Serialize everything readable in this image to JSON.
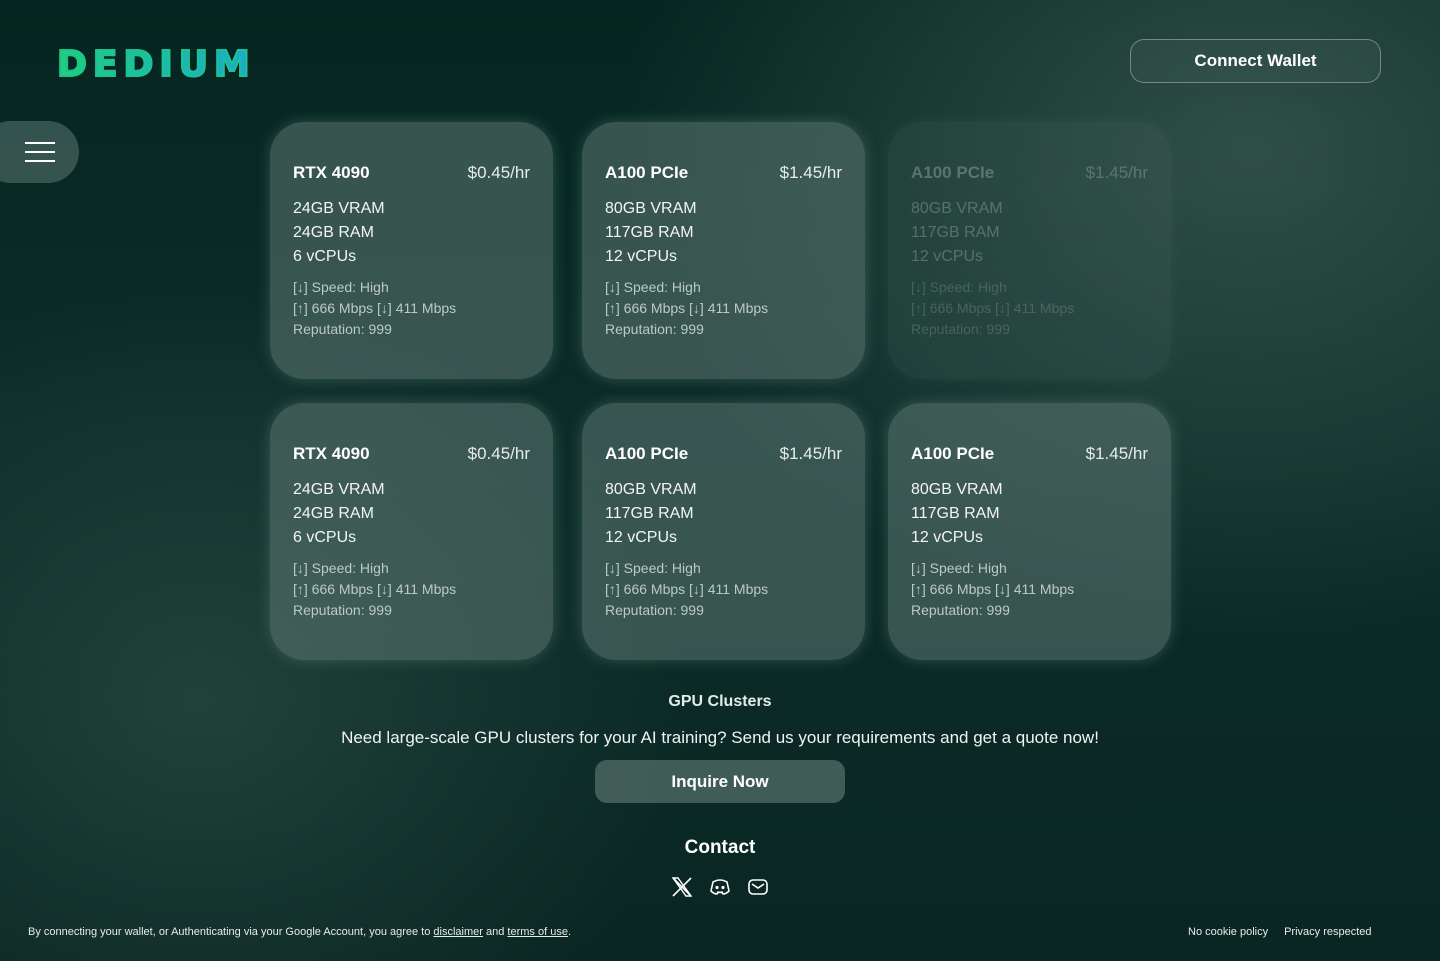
{
  "header": {
    "logo_text": "DEDIUM",
    "connect_wallet_label": "Connect Wallet"
  },
  "cards": [
    {
      "name": "RTX 4090",
      "price": "$0.45/hr",
      "vram": "24GB VRAM",
      "ram": "24GB RAM",
      "cpus": "6 vCPUs",
      "speed": "[↓] Speed: High",
      "bandwidth": "[↑] 666 Mbps [↓] 411 Mbps",
      "reputation": "Reputation: 999"
    },
    {
      "name": "A100 PCIe",
      "price": "$1.45/hr",
      "vram": "80GB VRAM",
      "ram": "117GB RAM",
      "cpus": "12 vCPUs",
      "speed": "[↓] Speed: High",
      "bandwidth": "[↑] 666 Mbps [↓] 411 Mbps",
      "reputation": "Reputation: 999"
    },
    {
      "name": "A100 PCIe",
      "price": "$1.45/hr",
      "vram": "80GB VRAM",
      "ram": "117GB RAM",
      "cpus": "12 vCPUs",
      "speed": "[↓] Speed: High",
      "bandwidth": "[↑] 666 Mbps [↓] 411 Mbps",
      "reputation": "Reputation: 999"
    },
    {
      "name": "RTX 4090",
      "price": "$0.45/hr",
      "vram": "24GB VRAM",
      "ram": "24GB RAM",
      "cpus": "6 vCPUs",
      "speed": "[↓] Speed: High",
      "bandwidth": "[↑] 666 Mbps [↓] 411 Mbps",
      "reputation": "Reputation: 999"
    },
    {
      "name": "A100 PCIe",
      "price": "$1.45/hr",
      "vram": "80GB VRAM",
      "ram": "117GB RAM",
      "cpus": "12 vCPUs",
      "speed": "[↓] Speed: High",
      "bandwidth": "[↑] 666 Mbps [↓] 411 Mbps",
      "reputation": "Reputation: 999"
    },
    {
      "name": "A100 PCIe",
      "price": "$1.45/hr",
      "vram": "80GB VRAM",
      "ram": "117GB RAM",
      "cpus": "12 vCPUs",
      "speed": "[↓] Speed: High",
      "bandwidth": "[↑] 666 Mbps [↓] 411 Mbps",
      "reputation": "Reputation: 999"
    }
  ],
  "clusters": {
    "title": "GPU Clusters",
    "description": "Need large-scale GPU clusters for your AI training? Send us your requirements and get a quote now!",
    "inquire_label": "Inquire Now"
  },
  "contact": {
    "title": "Contact",
    "icons": [
      "x-icon",
      "discord-icon",
      "mail-icon"
    ]
  },
  "footer": {
    "disclaimer_prefix": "By connecting your wallet, or Authenticating via your Google Account, you agree to",
    "disclaimer_link": "disclaimer",
    "and_text": "and",
    "terms_link": "terms of use",
    "period": ".",
    "no_cookie": "No cookie policy",
    "privacy": "Privacy respected"
  },
  "colors": {
    "logo_gradient_start": "#1fd07a",
    "logo_gradient_end": "#1aa8d8",
    "background": "#0a2622"
  }
}
